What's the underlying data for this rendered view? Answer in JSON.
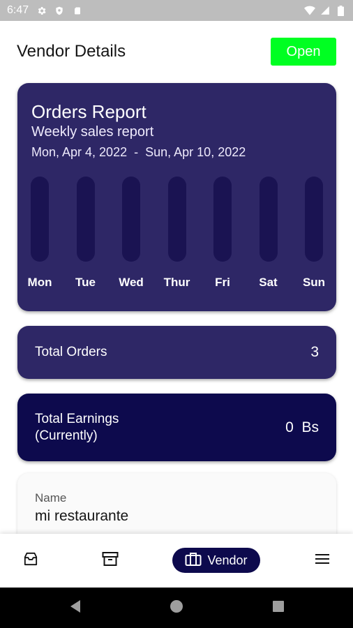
{
  "status_bar": {
    "time": "6:47",
    "left_icons": [
      "gear-icon",
      "shield-icon",
      "sd-card-icon"
    ],
    "right_icons": [
      "wifi-icon",
      "signal-icon",
      "battery-icon"
    ]
  },
  "header": {
    "title": "Vendor Details",
    "status_button": "Open",
    "status_color": "#00ff22"
  },
  "report": {
    "title": "Orders Report",
    "subtitle": "Weekly sales report",
    "range_start": "Mon, Apr 4, 2022",
    "range_separator": "-",
    "range_end": "Sun, Apr 10, 2022"
  },
  "chart_data": {
    "type": "bar",
    "categories": [
      "Mon",
      "Tue",
      "Wed",
      "Thur",
      "Fri",
      "Sat",
      "Sun"
    ],
    "values": [
      0,
      0,
      0,
      0,
      0,
      0,
      0
    ],
    "title": "",
    "ylim": [
      0,
      1
    ]
  },
  "total_orders": {
    "label": "Total Orders",
    "value": "3"
  },
  "total_earnings": {
    "label_line1": "Total Earnings",
    "label_line2": "(Currently)",
    "value": "0  Bs"
  },
  "vendor_info": {
    "name_label": "Name",
    "name_value": "mi restaurante"
  },
  "bottom_nav": {
    "items": [
      {
        "icon": "inbox-icon"
      },
      {
        "icon": "archive-icon"
      },
      {
        "icon": "briefcase-icon",
        "label": "Vendor",
        "active": true
      },
      {
        "icon": "menu-icon"
      }
    ]
  },
  "colors": {
    "card": "#2e2766",
    "card_dark": "#0d0a4d",
    "bar_track": "#1a1352"
  }
}
